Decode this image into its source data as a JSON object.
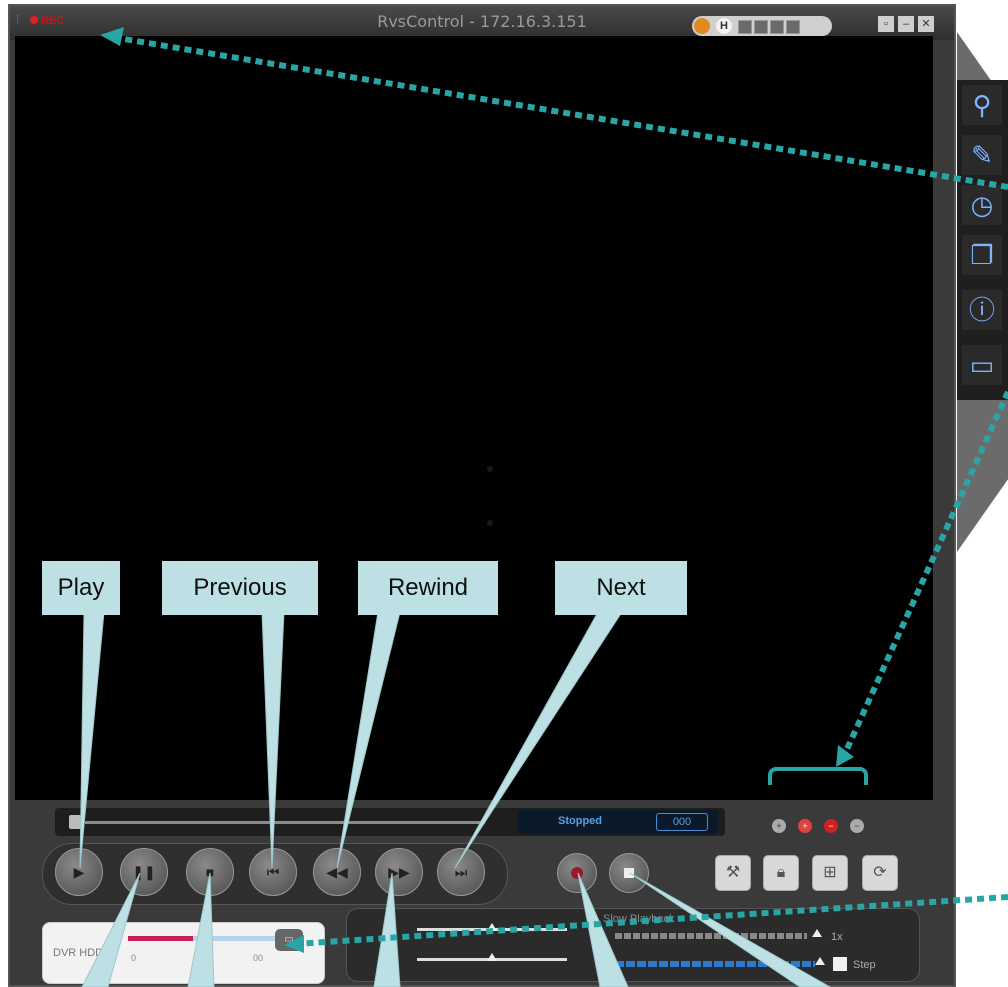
{
  "window": {
    "title": "RvsControl - 172.16.3.151",
    "rec_label": "REC",
    "h_badge": "H"
  },
  "status": {
    "text": "Stopped",
    "counter": "000"
  },
  "hdd": {
    "label": "DVR HDD",
    "used_fraction": 0.37,
    "min": "0",
    "max": "00"
  },
  "playback": {
    "slow_label": "Slow Playback",
    "speed_label": "1x",
    "step_label": "Step"
  },
  "callouts": {
    "play": "Play",
    "previous": "Previous",
    "rewind": "Rewind",
    "next": "Next"
  },
  "icons": {
    "sidebar": [
      "search-icon",
      "pencil-icon",
      "alarm-clock-icon",
      "copy-icon",
      "info-icon",
      "window-icon"
    ],
    "tools": [
      "wrench-icon",
      "lock-icon",
      "grid-icon",
      "refresh-icon"
    ]
  },
  "colors": {
    "callout": "#bde0e4",
    "annotation": "#2aa5a5",
    "record": "#9a1a2a",
    "hdd_used": "#c81e5a"
  }
}
